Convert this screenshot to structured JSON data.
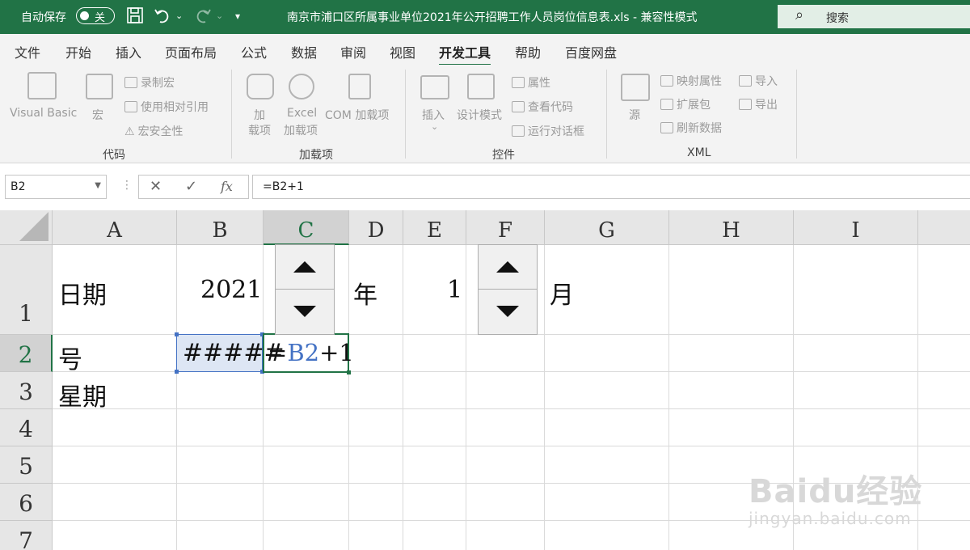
{
  "titlebar": {
    "autosave_label": "自动保存",
    "autosave_state": "关",
    "document_title": "南京市浦口区所属事业单位2021年公开招聘工作人员岗位信息表.xls  -  兼容性模式",
    "search_placeholder": "搜索"
  },
  "tabs": [
    "文件",
    "开始",
    "插入",
    "页面布局",
    "公式",
    "数据",
    "审阅",
    "视图",
    "开发工具",
    "帮助",
    "百度网盘"
  ],
  "active_tab": "开发工具",
  "ribbon": {
    "code": {
      "label": "代码",
      "visual_basic": "Visual Basic",
      "macro": "宏",
      "record_macro": "录制宏",
      "relative_ref": "使用相对引用",
      "macro_security": "宏安全性"
    },
    "addins": {
      "label": "加载项",
      "addin_line1": "加",
      "addin_line2": "载项",
      "excel_line1": "Excel",
      "excel_line2": "加载项",
      "com_addin": "COM 加载项"
    },
    "controls": {
      "label": "控件",
      "insert": "插入",
      "design_mode": "设计模式",
      "properties": "属性",
      "view_code": "查看代码",
      "run_dialog": "运行对话框"
    },
    "xml": {
      "label": "XML",
      "source": "源",
      "map_properties": "映射属性",
      "expansion_packs": "扩展包",
      "refresh_data": "刷新数据",
      "import": "导入",
      "export": "导出"
    }
  },
  "formula_bar": {
    "name_box": "B2",
    "formula": "=B2+1"
  },
  "columns": [
    "A",
    "B",
    "C",
    "D",
    "E",
    "F",
    "G",
    "H",
    "I"
  ],
  "rows": [
    "1",
    "2",
    "3",
    "4",
    "5",
    "6",
    "7"
  ],
  "selected_column": "C",
  "selected_row": "2",
  "cells": {
    "A1": "日期",
    "B1": "2021",
    "D1": "年",
    "E1": "1",
    "G1": "月",
    "A2": "号",
    "B2": "#####",
    "C2_eq": "=",
    "C2_ref": "B2",
    "C2_rest": "+1",
    "A3": "星期"
  },
  "colors": {
    "excel_green": "#217346",
    "ref_blue": "#4472c4"
  },
  "watermark": {
    "main": "Baidu经验",
    "sub": "jingyan.baidu.com"
  }
}
